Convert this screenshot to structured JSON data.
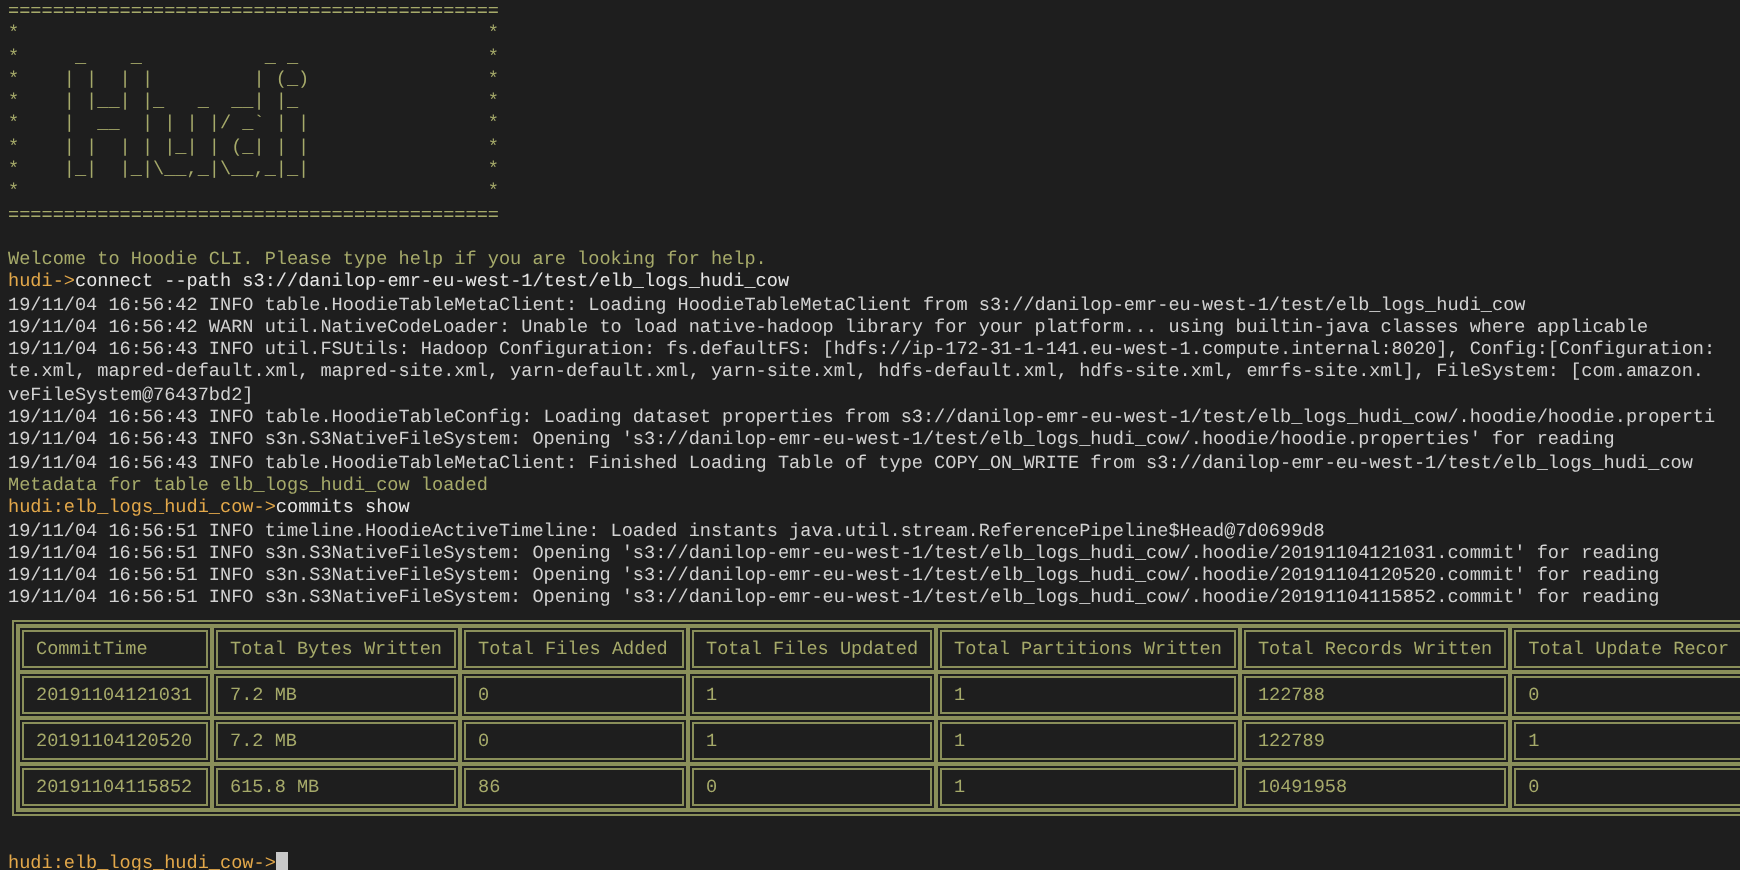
{
  "banner": [
    "============================================",
    "*                                          *",
    "*     _    _           _ _                 *",
    "*    | |  | |         | (_)                *",
    "*    | |__| |_   _  __| |_                 *",
    "*    |  __  | | | |/ _` | |                *",
    "*    | |  | | |_| | (_| | |                *",
    "*    |_|  |_|\\__,_|\\__,_|_|                *",
    "*                                          *",
    "============================================"
  ],
  "lines": [
    {
      "kind": "notice",
      "text": "Welcome to Hoodie CLI. Please type help if you are looking for help."
    },
    {
      "kind": "prompt",
      "prompt": "hudi->",
      "command": "connect --path s3://danilop-emr-eu-west-1/test/elb_logs_hudi_cow"
    },
    {
      "kind": "log",
      "text": "19/11/04 16:56:42 INFO table.HoodieTableMetaClient: Loading HoodieTableMetaClient from s3://danilop-emr-eu-west-1/test/elb_logs_hudi_cow"
    },
    {
      "kind": "log",
      "text": "19/11/04 16:56:42 WARN util.NativeCodeLoader: Unable to load native-hadoop library for your platform... using builtin-java classes where applicable"
    },
    {
      "kind": "log",
      "text": "19/11/04 16:56:43 INFO util.FSUtils: Hadoop Configuration: fs.defaultFS: [hdfs://ip-172-31-1-141.eu-west-1.compute.internal:8020], Config:[Configuration:"
    },
    {
      "kind": "log",
      "text": "te.xml, mapred-default.xml, mapred-site.xml, yarn-default.xml, yarn-site.xml, hdfs-default.xml, hdfs-site.xml, emrfs-site.xml], FileSystem: [com.amazon."
    },
    {
      "kind": "log",
      "text": "veFileSystem@76437bd2]"
    },
    {
      "kind": "log",
      "text": "19/11/04 16:56:43 INFO table.HoodieTableConfig: Loading dataset properties from s3://danilop-emr-eu-west-1/test/elb_logs_hudi_cow/.hoodie/hoodie.properti"
    },
    {
      "kind": "log",
      "text": "19/11/04 16:56:43 INFO s3n.S3NativeFileSystem: Opening 's3://danilop-emr-eu-west-1/test/elb_logs_hudi_cow/.hoodie/hoodie.properties' for reading"
    },
    {
      "kind": "log",
      "text": "19/11/04 16:56:43 INFO table.HoodieTableMetaClient: Finished Loading Table of type COPY_ON_WRITE from s3://danilop-emr-eu-west-1/test/elb_logs_hudi_cow"
    },
    {
      "kind": "notice",
      "text": "Metadata for table elb_logs_hudi_cow loaded"
    },
    {
      "kind": "prompt",
      "prompt": "hudi:elb_logs_hudi_cow->",
      "command": "commits show"
    },
    {
      "kind": "log",
      "text": "19/11/04 16:56:51 INFO timeline.HoodieActiveTimeline: Loaded instants java.util.stream.ReferencePipeline$Head@7d0699d8"
    },
    {
      "kind": "log",
      "text": "19/11/04 16:56:51 INFO s3n.S3NativeFileSystem: Opening 's3://danilop-emr-eu-west-1/test/elb_logs_hudi_cow/.hoodie/20191104121031.commit' for reading"
    },
    {
      "kind": "log",
      "text": "19/11/04 16:56:51 INFO s3n.S3NativeFileSystem: Opening 's3://danilop-emr-eu-west-1/test/elb_logs_hudi_cow/.hoodie/20191104120520.commit' for reading"
    },
    {
      "kind": "log",
      "text": "19/11/04 16:56:51 INFO s3n.S3NativeFileSystem: Opening 's3://danilop-emr-eu-west-1/test/elb_logs_hudi_cow/.hoodie/20191104115852.commit' for reading"
    }
  ],
  "table": {
    "columns": [
      "CommitTime",
      "Total Bytes Written",
      "Total Files Added",
      "Total Files Updated",
      "Total Partitions Written",
      "Total Records Written",
      "Total Update Recor"
    ],
    "rows": [
      [
        "20191104121031",
        "7.2 MB",
        "0",
        "1",
        "1",
        "122788",
        "0"
      ],
      [
        "20191104120520",
        "7.2 MB",
        "0",
        "1",
        "1",
        "122789",
        "1"
      ],
      [
        "20191104115852",
        "615.8 MB",
        "86",
        "0",
        "1",
        "10491958",
        "0"
      ]
    ]
  },
  "prompt": {
    "prompt": "hudi:elb_logs_hudi_cow->"
  }
}
